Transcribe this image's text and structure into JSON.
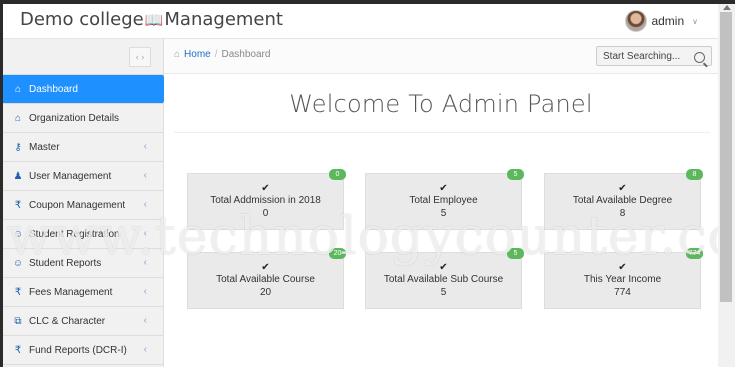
{
  "header": {
    "brand_left": "Demo college",
    "brand_icon": "open-book-icon",
    "brand_right": "Management",
    "user_name": "admin"
  },
  "sidebar": {
    "toggle_label": "‹ ›",
    "items": [
      {
        "label": "Dashboard",
        "icon": "home-icon",
        "active": true
      },
      {
        "label": "Organization Details",
        "icon": "home-icon"
      },
      {
        "label": "Master",
        "icon": "key-icon"
      },
      {
        "label": "User Management",
        "icon": "user-icon"
      },
      {
        "label": "Coupon Management",
        "icon": "rupee-icon"
      },
      {
        "label": "Student Registration",
        "icon": "users-icon"
      },
      {
        "label": "Student Reports",
        "icon": "users-icon"
      },
      {
        "label": "Fees Management",
        "icon": "rupee-icon"
      },
      {
        "label": "CLC & Character",
        "icon": "external-link-icon"
      },
      {
        "label": "Fund Reports (DCR-I)",
        "icon": "rupee-icon"
      }
    ]
  },
  "breadcrumb": {
    "home": "Home",
    "separator": "/",
    "current": "Dashboard"
  },
  "search": {
    "placeholder": "Start Searching..."
  },
  "welcome": "Welcome To Admin Panel",
  "cards": [
    {
      "label": "Total Addmission in 2018",
      "value": "0",
      "badge": "0"
    },
    {
      "label": "Total Employee",
      "value": "5",
      "badge": "5"
    },
    {
      "label": "Total Available Degree",
      "value": "8",
      "badge": "8"
    },
    {
      "label": "Total Available Course",
      "value": "20",
      "badge": "20"
    },
    {
      "label": "Total Available Sub Course",
      "value": "5",
      "badge": "5"
    },
    {
      "label": "This Year Income",
      "value": "774",
      "badge": "774"
    }
  ],
  "watermark": "www.technologycounter.com",
  "colors": {
    "accent": "#1e90ff",
    "badge": "#5cb85c",
    "card_bg": "#eaeaea"
  }
}
